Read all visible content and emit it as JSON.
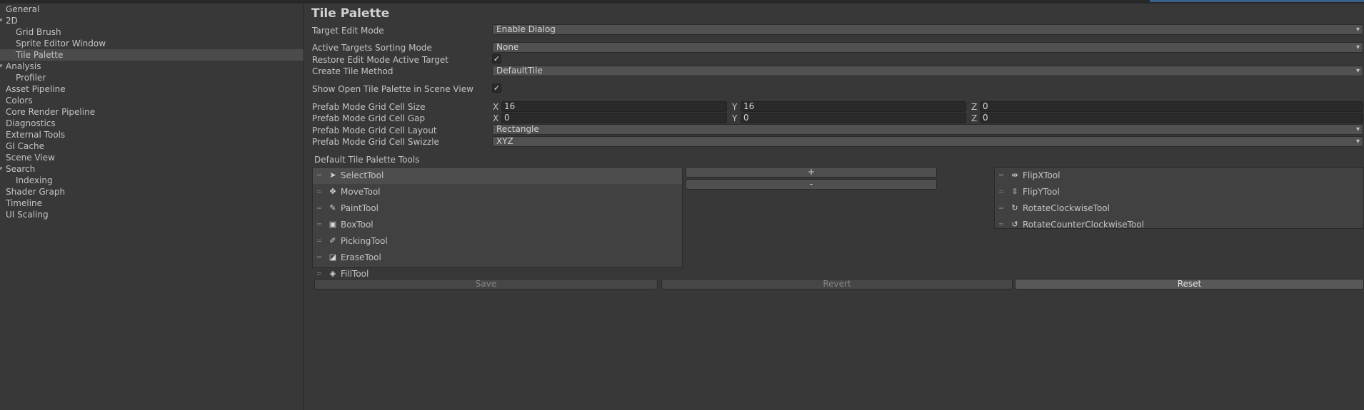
{
  "sidebar": {
    "items": [
      {
        "label": "General",
        "level": 0
      },
      {
        "label": "2D",
        "level": 0,
        "expanded": true
      },
      {
        "label": "Grid Brush",
        "level": 1
      },
      {
        "label": "Sprite Editor Window",
        "level": 1
      },
      {
        "label": "Tile Palette",
        "level": 1,
        "selected": true
      },
      {
        "label": "Analysis",
        "level": 0,
        "expanded": true
      },
      {
        "label": "Profiler",
        "level": 1
      },
      {
        "label": "Asset Pipeline",
        "level": 0
      },
      {
        "label": "Colors",
        "level": 0
      },
      {
        "label": "Core Render Pipeline",
        "level": 0
      },
      {
        "label": "Diagnostics",
        "level": 0
      },
      {
        "label": "External Tools",
        "level": 0
      },
      {
        "label": "GI Cache",
        "level": 0
      },
      {
        "label": "Scene View",
        "level": 0
      },
      {
        "label": "Search",
        "level": 0,
        "expanded": true
      },
      {
        "label": "Indexing",
        "level": 1
      },
      {
        "label": "Shader Graph",
        "level": 0
      },
      {
        "label": "Timeline",
        "level": 0
      },
      {
        "label": "UI Scaling",
        "level": 0
      }
    ]
  },
  "main": {
    "title": "Tile Palette",
    "target_edit_mode": {
      "label": "Target Edit Mode",
      "value": "Enable Dialog"
    },
    "active_targets_sorting_mode": {
      "label": "Active Targets Sorting Mode",
      "value": "None"
    },
    "restore_edit_mode": {
      "label": "Restore Edit Mode Active Target",
      "checked": true
    },
    "create_tile_method": {
      "label": "Create Tile Method",
      "value": "DefaultTile"
    },
    "show_open_tile_palette": {
      "label": "Show Open Tile Palette in Scene View",
      "checked": true
    },
    "grid_cell_size": {
      "label": "Prefab Mode Grid Cell Size",
      "x": "16",
      "y": "16",
      "z": "0"
    },
    "grid_cell_gap": {
      "label": "Prefab Mode Grid Cell Gap",
      "x": "0",
      "y": "0",
      "z": "0"
    },
    "axis_labels": {
      "x": "X",
      "y": "Y",
      "z": "Z"
    },
    "grid_cell_layout": {
      "label": "Prefab Mode Grid Cell Layout",
      "value": "Rectangle"
    },
    "grid_cell_swizzle": {
      "label": "Prefab Mode Grid Cell Swizzle",
      "value": "XYZ"
    },
    "default_tools": {
      "label": "Default Tile Palette Tools",
      "left_list": [
        {
          "name": "SelectTool",
          "icon": "select-arrow-icon",
          "glyph": "➤",
          "selected": true
        },
        {
          "name": "MoveTool",
          "icon": "move-icon",
          "glyph": "✥"
        },
        {
          "name": "PaintTool",
          "icon": "paint-brush-icon",
          "glyph": "✎"
        },
        {
          "name": "BoxTool",
          "icon": "box-fill-icon",
          "glyph": "▣"
        },
        {
          "name": "PickingTool",
          "icon": "eyedropper-icon",
          "glyph": "✐"
        },
        {
          "name": "EraseTool",
          "icon": "eraser-icon",
          "glyph": "◪"
        },
        {
          "name": "FillTool",
          "icon": "paint-bucket-icon",
          "glyph": "◈"
        }
      ],
      "right_list": [
        {
          "name": "FlipXTool",
          "icon": "flip-x-icon",
          "glyph": "⇹"
        },
        {
          "name": "FlipYTool",
          "icon": "flip-y-icon",
          "glyph": "⇳"
        },
        {
          "name": "RotateClockwiseTool",
          "icon": "rotate-cw-icon",
          "glyph": "↻"
        },
        {
          "name": "RotateCounterClockwiseTool",
          "icon": "rotate-ccw-icon",
          "glyph": "↺"
        }
      ],
      "add_label": "+",
      "remove_label": "-"
    },
    "buttons": {
      "save": "Save",
      "revert": "Revert",
      "reset": "Reset"
    },
    "drag_handle_glyph": "═",
    "dropdown_caret": "▾",
    "tree_arrow_glyph": "▾",
    "check_glyph": "✓"
  }
}
